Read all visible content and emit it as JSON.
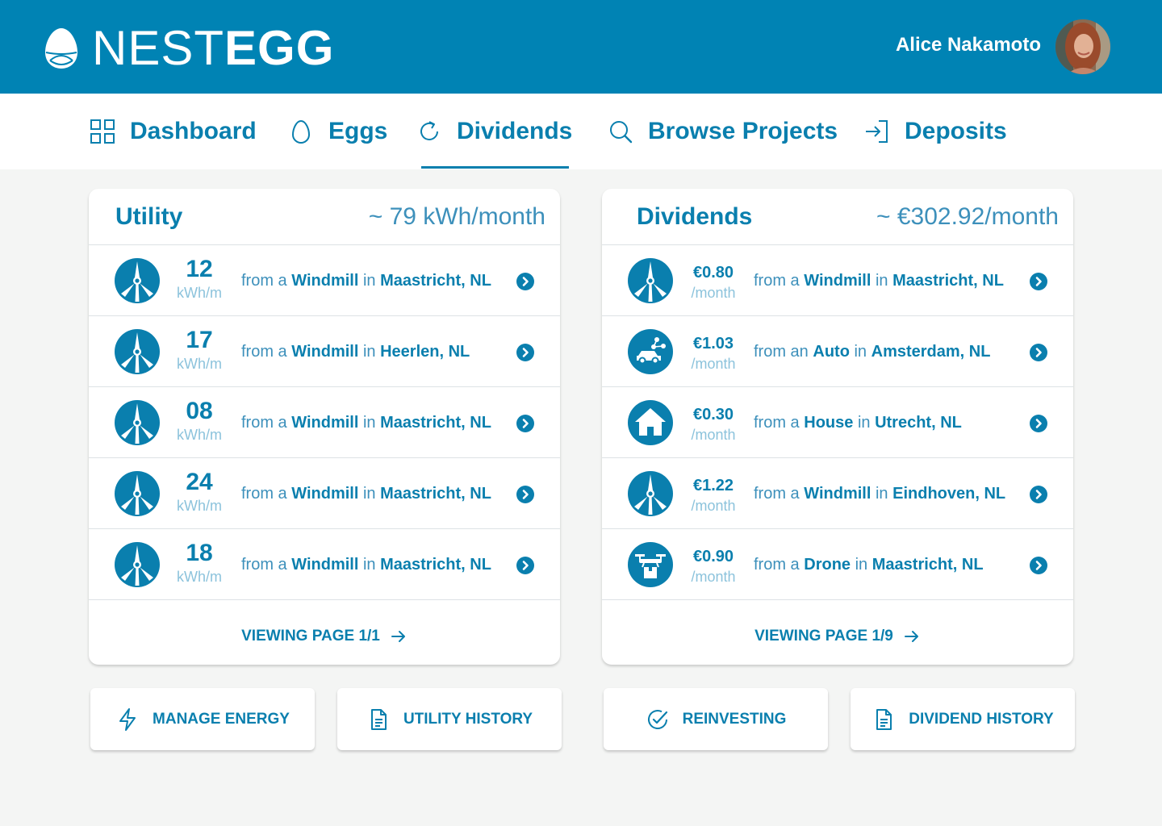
{
  "header": {
    "brand_light": "NEST",
    "brand_bold": "EGG",
    "user_name": "Alice Nakamoto"
  },
  "nav": {
    "items": [
      {
        "label": "Dashboard",
        "icon": "grid-icon"
      },
      {
        "label": "Eggs",
        "icon": "egg-icon"
      },
      {
        "label": "Dividends",
        "icon": "refresh-icon",
        "active": true
      },
      {
        "label": "Browse Projects",
        "icon": "search-icon"
      },
      {
        "label": "Deposits",
        "icon": "sign-in-icon"
      }
    ]
  },
  "utility": {
    "title": "Utility",
    "total": "~ 79 kWh/month",
    "rows": [
      {
        "amount": "12",
        "unit": "kWh/m",
        "prefix": "from a",
        "type": "Windmill",
        "sep": "in",
        "place": "Maastricht, NL",
        "icon": "windmill-icon"
      },
      {
        "amount": "17",
        "unit": "kWh/m",
        "prefix": "from a",
        "type": "Windmill",
        "sep": "in",
        "place": "Heerlen, NL",
        "icon": "windmill-icon"
      },
      {
        "amount": "08",
        "unit": "kWh/m",
        "prefix": "from a",
        "type": "Windmill",
        "sep": "in",
        "place": "Maastricht, NL",
        "icon": "windmill-icon"
      },
      {
        "amount": "24",
        "unit": "kWh/m",
        "prefix": "from a",
        "type": "Windmill",
        "sep": "in",
        "place": "Maastricht, NL",
        "icon": "windmill-icon"
      },
      {
        "amount": "18",
        "unit": "kWh/m",
        "prefix": "from a",
        "type": "Windmill",
        "sep": "in",
        "place": "Maastricht, NL",
        "icon": "windmill-icon"
      }
    ],
    "footer": "VIEWING PAGE 1/1"
  },
  "dividends": {
    "title": "Dividends",
    "total": "~ €302.92/month",
    "rows": [
      {
        "amount": "€0.80",
        "unit": "/month",
        "prefix": "from a",
        "type": "Windmill",
        "sep": "in",
        "place": "Maastricht, NL",
        "icon": "windmill-icon"
      },
      {
        "amount": "€1.03",
        "unit": "/month",
        "prefix": "from an",
        "type": "Auto",
        "sep": "in",
        "place": "Amsterdam, NL",
        "icon": "car-share-icon"
      },
      {
        "amount": "€0.30",
        "unit": "/month",
        "prefix": "from a",
        "type": "House",
        "sep": "in",
        "place": "Utrecht, NL",
        "icon": "house-icon"
      },
      {
        "amount": "€1.22",
        "unit": "/month",
        "prefix": "from a",
        "type": "Windmill",
        "sep": "in",
        "place": "Eindhoven, NL",
        "icon": "windmill-icon"
      },
      {
        "amount": "€0.90",
        "unit": "/month",
        "prefix": "from a",
        "type": "Drone",
        "sep": "in",
        "place": "Maastricht, NL",
        "icon": "drone-icon"
      }
    ],
    "footer": "VIEWING PAGE 1/9"
  },
  "actions": {
    "manage_energy": "MANAGE ENERGY",
    "utility_history": "UTILITY HISTORY",
    "reinvesting": "REINVESTING",
    "dividend_history": "DIVIDEND HISTORY"
  },
  "colors": {
    "brand": "#0083b4",
    "accent": "#0a7fae",
    "muted": "#8cc3dc",
    "background": "#f4f5f4"
  }
}
